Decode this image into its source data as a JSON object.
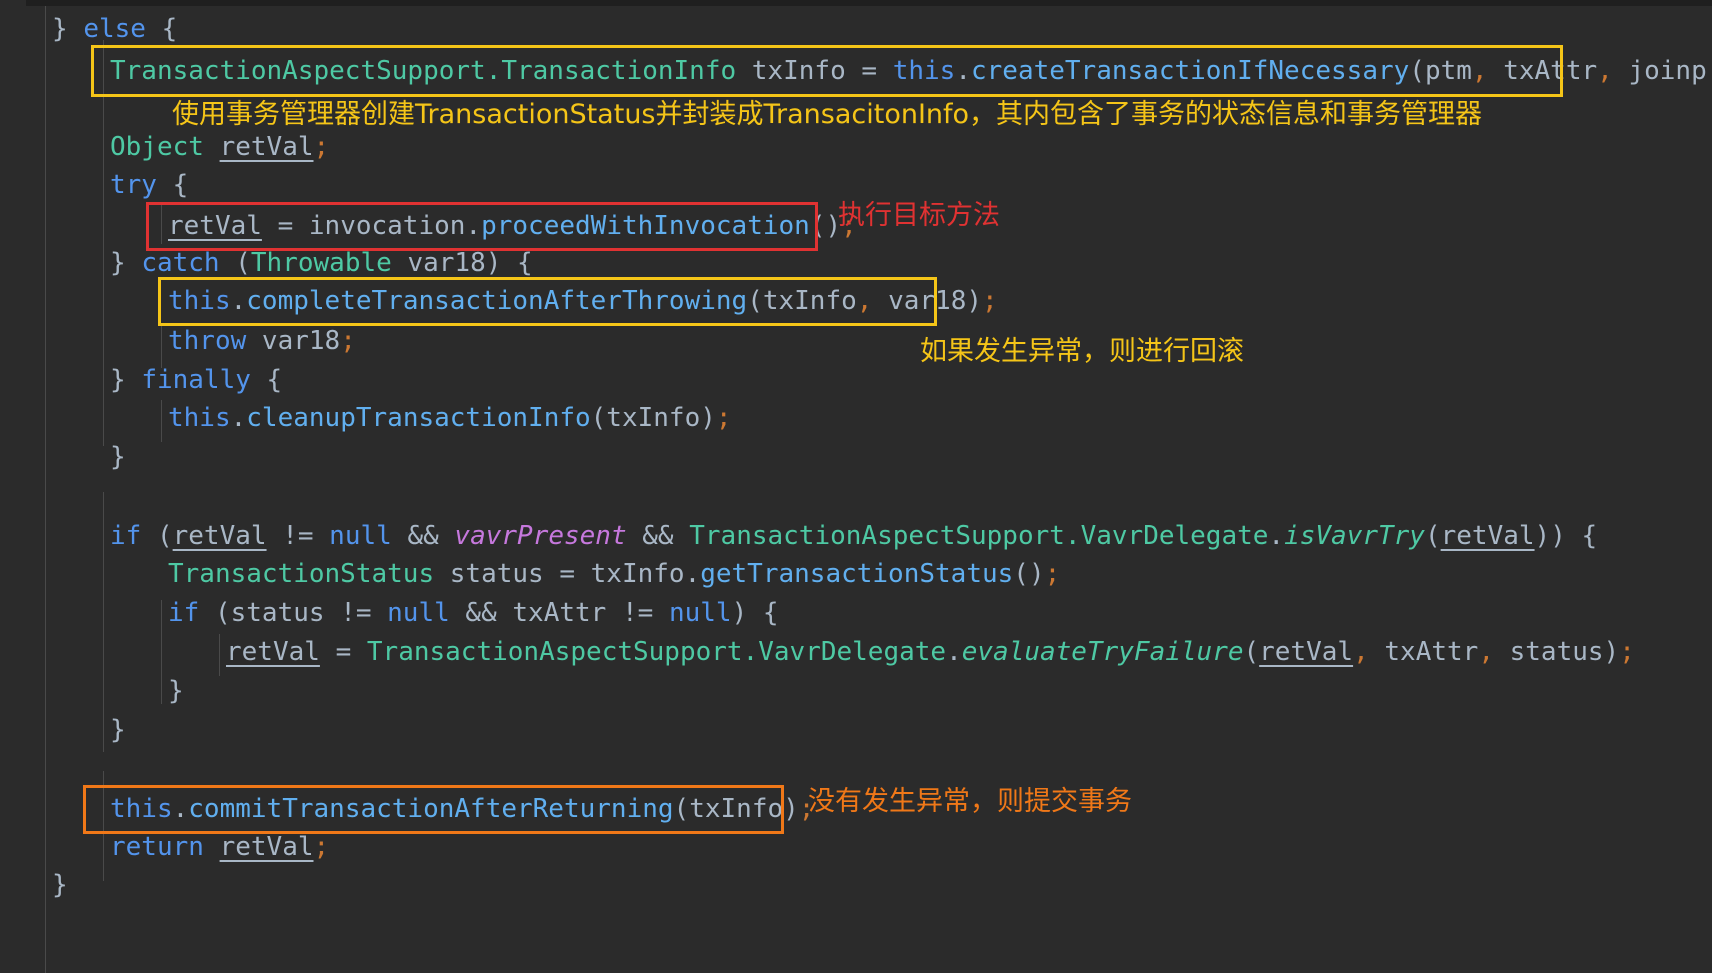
{
  "editor": {
    "theme": "darcula-dark",
    "background": "#2b2b2b",
    "default_text_color": "#a9b7c6"
  },
  "colors": {
    "keyword_orange": "#cc7832",
    "keyword_blue": "#5394ec",
    "class_green": "#4ec9a4",
    "method_blue": "#61afef",
    "field_purple": "#c678dd",
    "annotation_yellow": "#f5c518",
    "annotation_red": "#e03232",
    "annotation_orange": "#f07818",
    "box_yellow": "#f5c518",
    "box_red": "#e03232",
    "box_orange": "#f07818"
  },
  "code_lines": [
    {
      "id": "l01",
      "indent": 1,
      "text": "} else {"
    },
    {
      "id": "l02",
      "indent": 2,
      "text": "TransactionAspectSupport.TransactionInfo txInfo = this.createTransactionIfNecessary(ptm, txAttr, joinp"
    },
    {
      "id": "l03",
      "indent": 2,
      "text": "Object retVal;"
    },
    {
      "id": "l04",
      "indent": 2,
      "text": "try {"
    },
    {
      "id": "l05",
      "indent": 3,
      "text": "retVal = invocation.proceedWithInvocation();"
    },
    {
      "id": "l06",
      "indent": 2,
      "text": "} catch (Throwable var18) {"
    },
    {
      "id": "l07",
      "indent": 3,
      "text": "this.completeTransactionAfterThrowing(txInfo, var18);"
    },
    {
      "id": "l08",
      "indent": 3,
      "text": "throw var18;"
    },
    {
      "id": "l09",
      "indent": 2,
      "text": "} finally {"
    },
    {
      "id": "l10",
      "indent": 3,
      "text": "this.cleanupTransactionInfo(txInfo);"
    },
    {
      "id": "l11",
      "indent": 2,
      "text": "}"
    },
    {
      "id": "l12",
      "indent": 0,
      "text": ""
    },
    {
      "id": "l13",
      "indent": 2,
      "text": "if (retVal != null && vavrPresent && TransactionAspectSupport.VavrDelegate.isVavrTry(retVal)) {"
    },
    {
      "id": "l14",
      "indent": 3,
      "text": "TransactionStatus status = txInfo.getTransactionStatus();"
    },
    {
      "id": "l15",
      "indent": 3,
      "text": "if (status != null && txAttr != null) {"
    },
    {
      "id": "l16",
      "indent": 4,
      "text": "retVal = TransactionAspectSupport.VavrDelegate.evaluateTryFailure(retVal, txAttr, status);"
    },
    {
      "id": "l17",
      "indent": 3,
      "text": "}"
    },
    {
      "id": "l18",
      "indent": 2,
      "text": "}"
    },
    {
      "id": "l19",
      "indent": 0,
      "text": ""
    },
    {
      "id": "l20",
      "indent": 2,
      "text": "this.commitTransactionAfterReturning(txInfo);"
    },
    {
      "id": "l21",
      "indent": 2,
      "text": "return retVal;"
    },
    {
      "id": "l22",
      "indent": 1,
      "text": "}"
    }
  ],
  "tokens": {
    "l01": [
      {
        "t": "}",
        "c": "brace"
      },
      {
        "t": " ",
        "c": "plain"
      },
      {
        "t": "else",
        "c": "kw2"
      },
      {
        "t": " {",
        "c": "brace"
      }
    ],
    "l02": [
      {
        "t": "TransactionAspectSupport",
        "c": "type"
      },
      {
        "t": ".",
        "c": "type"
      },
      {
        "t": "TransactionInfo",
        "c": "type"
      },
      {
        "t": " txInfo ",
        "c": "ident"
      },
      {
        "t": "=",
        "c": "ident"
      },
      {
        "t": " ",
        "c": "ident"
      },
      {
        "t": "this",
        "c": "kw2"
      },
      {
        "t": ".",
        "c": "ident"
      },
      {
        "t": "createTransactionIfNecessary",
        "c": "method"
      },
      {
        "t": "(",
        "c": "ident"
      },
      {
        "t": "ptm",
        "c": "ident"
      },
      {
        "t": ",",
        "c": "punc"
      },
      {
        "t": " txAttr",
        "c": "ident"
      },
      {
        "t": ",",
        "c": "punc"
      },
      {
        "t": " joinp",
        "c": "ident"
      }
    ],
    "l03": [
      {
        "t": "Object",
        "c": "type"
      },
      {
        "t": " ",
        "c": "ident"
      },
      {
        "t": "retVal",
        "c": "local"
      },
      {
        "t": ";",
        "c": "semi"
      }
    ],
    "l04": [
      {
        "t": "try",
        "c": "kw2"
      },
      {
        "t": " {",
        "c": "brace"
      }
    ],
    "l05": [
      {
        "t": "retVal",
        "c": "local"
      },
      {
        "t": " = ",
        "c": "ident"
      },
      {
        "t": "invocation",
        "c": "ident"
      },
      {
        "t": ".",
        "c": "ident"
      },
      {
        "t": "proceedWithInvocation",
        "c": "method"
      },
      {
        "t": "()",
        "c": "ident"
      },
      {
        "t": ";",
        "c": "semi"
      }
    ],
    "l06": [
      {
        "t": "} ",
        "c": "brace"
      },
      {
        "t": "catch",
        "c": "kw2"
      },
      {
        "t": " (",
        "c": "ident"
      },
      {
        "t": "Throwable",
        "c": "type"
      },
      {
        "t": " var18) {",
        "c": "ident"
      }
    ],
    "l07": [
      {
        "t": "this",
        "c": "kw2"
      },
      {
        "t": ".",
        "c": "ident"
      },
      {
        "t": "completeTransactionAfterThrowing",
        "c": "method"
      },
      {
        "t": "(",
        "c": "ident"
      },
      {
        "t": "txInfo",
        "c": "ident"
      },
      {
        "t": ",",
        "c": "punc"
      },
      {
        "t": " var18)",
        "c": "ident"
      },
      {
        "t": ";",
        "c": "semi"
      }
    ],
    "l08": [
      {
        "t": "throw",
        "c": "kw2"
      },
      {
        "t": " var18",
        "c": "ident"
      },
      {
        "t": ";",
        "c": "semi"
      }
    ],
    "l09": [
      {
        "t": "} ",
        "c": "brace"
      },
      {
        "t": "finally",
        "c": "kw2"
      },
      {
        "t": " {",
        "c": "brace"
      }
    ],
    "l10": [
      {
        "t": "this",
        "c": "kw2"
      },
      {
        "t": ".",
        "c": "ident"
      },
      {
        "t": "cleanupTransactionInfo",
        "c": "method"
      },
      {
        "t": "(txInfo)",
        "c": "ident"
      },
      {
        "t": ";",
        "c": "semi"
      }
    ],
    "l11": [
      {
        "t": "}",
        "c": "brace"
      }
    ],
    "l12": [
      {
        "t": "",
        "c": "plain"
      }
    ],
    "l13": [
      {
        "t": "if",
        "c": "kw2"
      },
      {
        "t": " (",
        "c": "ident"
      },
      {
        "t": "retVal",
        "c": "local"
      },
      {
        "t": " != ",
        "c": "ident"
      },
      {
        "t": "null",
        "c": "kw2"
      },
      {
        "t": " && ",
        "c": "ident"
      },
      {
        "t": "vavrPresent",
        "c": "field"
      },
      {
        "t": " && ",
        "c": "ident"
      },
      {
        "t": "TransactionAspectSupport",
        "c": "type"
      },
      {
        "t": ".",
        "c": "type"
      },
      {
        "t": "VavrDelegate",
        "c": "type"
      },
      {
        "t": ".",
        "c": "ident"
      },
      {
        "t": "isVavrTry",
        "c": "fielditalic"
      },
      {
        "t": "(",
        "c": "ident"
      },
      {
        "t": "retVal",
        "c": "local"
      },
      {
        "t": ")) {",
        "c": "ident"
      }
    ],
    "l14": [
      {
        "t": "TransactionStatus",
        "c": "type"
      },
      {
        "t": " status = txInfo",
        "c": "ident"
      },
      {
        "t": ".",
        "c": "ident"
      },
      {
        "t": "getTransactionStatus",
        "c": "method"
      },
      {
        "t": "()",
        "c": "ident"
      },
      {
        "t": ";",
        "c": "semi"
      }
    ],
    "l15": [
      {
        "t": "if",
        "c": "kw2"
      },
      {
        "t": " (status != ",
        "c": "ident"
      },
      {
        "t": "null",
        "c": "kw2"
      },
      {
        "t": " && txAttr != ",
        "c": "ident"
      },
      {
        "t": "null",
        "c": "kw2"
      },
      {
        "t": ") {",
        "c": "ident"
      }
    ],
    "l16": [
      {
        "t": "retVal",
        "c": "local"
      },
      {
        "t": " = ",
        "c": "ident"
      },
      {
        "t": "TransactionAspectSupport",
        "c": "type"
      },
      {
        "t": ".",
        "c": "type"
      },
      {
        "t": "VavrDelegate",
        "c": "type"
      },
      {
        "t": ".",
        "c": "ident"
      },
      {
        "t": "evaluateTryFailure",
        "c": "fielditalic"
      },
      {
        "t": "(",
        "c": "ident"
      },
      {
        "t": "retVal",
        "c": "local"
      },
      {
        "t": ",",
        "c": "punc"
      },
      {
        "t": " txAttr",
        "c": "ident"
      },
      {
        "t": ",",
        "c": "punc"
      },
      {
        "t": " status)",
        "c": "ident"
      },
      {
        "t": ";",
        "c": "semi"
      }
    ],
    "l17": [
      {
        "t": "}",
        "c": "brace"
      }
    ],
    "l18": [
      {
        "t": "}",
        "c": "brace"
      }
    ],
    "l19": [
      {
        "t": "",
        "c": "plain"
      }
    ],
    "l20": [
      {
        "t": "this",
        "c": "kw2"
      },
      {
        "t": ".",
        "c": "ident"
      },
      {
        "t": "commitTransactionAfterReturning",
        "c": "method"
      },
      {
        "t": "(txInfo)",
        "c": "ident"
      },
      {
        "t": ";",
        "c": "semi"
      }
    ],
    "l21": [
      {
        "t": "return",
        "c": "kw2"
      },
      {
        "t": " ",
        "c": "ident"
      },
      {
        "t": "retVal",
        "c": "local"
      },
      {
        "t": ";",
        "c": "semi"
      }
    ],
    "l22": [
      {
        "t": "}",
        "c": "brace"
      }
    ]
  },
  "annotations": [
    {
      "id": "anno1",
      "text": "使用事务管理器创建TransactionStatus并封装成TransacitonInfo，其内包含了事务的状态信息和事务管理器",
      "color": "#f5c518",
      "style": "yellow"
    },
    {
      "id": "anno2",
      "text": "执行目标方法",
      "color": "#e03232",
      "style": "red"
    },
    {
      "id": "anno3",
      "text": "如果发生异常，则进行回滚",
      "color": "#f5c518",
      "style": "yellow"
    },
    {
      "id": "anno4",
      "text": "没有发生异常，则提交事务",
      "color": "#f07818",
      "style": "orange"
    }
  ],
  "highlight_boxes": [
    {
      "id": "box-create-transaction",
      "color": "#f5c518",
      "target_line": "l02"
    },
    {
      "id": "box-proceed-invocation",
      "color": "#e03232",
      "target_line": "l05"
    },
    {
      "id": "box-complete-after-throwing",
      "color": "#f5c518",
      "target_line": "l07"
    },
    {
      "id": "box-commit-after-returning",
      "color": "#f07818",
      "target_line": "l20"
    }
  ]
}
